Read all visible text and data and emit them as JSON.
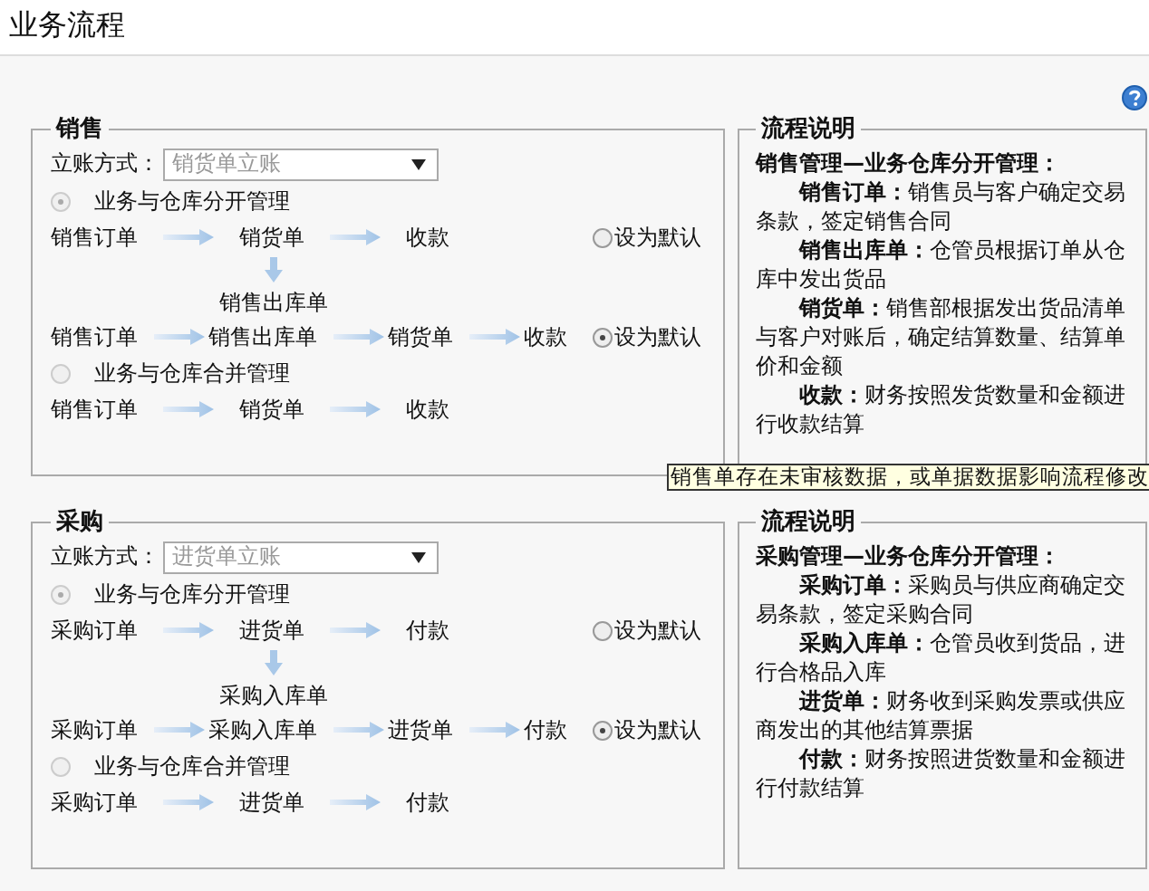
{
  "page": {
    "title": "业务流程"
  },
  "sections": [
    {
      "legend": "销售",
      "account_label": "立账方式：",
      "account_value": "销货单立账",
      "options": [
        {
          "label": "业务与仓库分开管理",
          "selected": true,
          "flows": [
            {
              "steps": [
                "销售订单",
                "销货单",
                "收款"
              ],
              "branch": "销售出库单",
              "default_label": "设为默认",
              "default_selected": false
            },
            {
              "steps": [
                "销售订单",
                "销售出库单",
                "销货单",
                "收款"
              ],
              "default_label": "设为默认",
              "default_selected": true
            }
          ]
        },
        {
          "label": "业务与仓库合并管理",
          "selected": false,
          "flows": [
            {
              "steps": [
                "销售订单",
                "销货单",
                "收款"
              ]
            }
          ]
        }
      ],
      "explanation": {
        "legend": "流程说明",
        "heading": "销售管理—业务仓库分开管理：",
        "items": [
          "**销售订单：**销售员与客户确定交易条款，签定销售合同",
          "**销售出库单：**仓管员根据订单从仓库中发出货品",
          "**销货单：**销售部根据发出货品清单与客户对账后，确定结算数量、结算单价和金额",
          "**收款：**财务按照发货数量和金额进行收款结算"
        ]
      }
    },
    {
      "legend": "采购",
      "account_label": "立账方式：",
      "account_value": "进货单立账",
      "options": [
        {
          "label": "业务与仓库分开管理",
          "selected": true,
          "flows": [
            {
              "steps": [
                "采购订单",
                "进货单",
                "付款"
              ],
              "branch": "采购入库单",
              "default_label": "设为默认",
              "default_selected": false
            },
            {
              "steps": [
                "采购订单",
                "采购入库单",
                "进货单",
                "付款"
              ],
              "default_label": "设为默认",
              "default_selected": true
            }
          ]
        },
        {
          "label": "业务与仓库合并管理",
          "selected": false,
          "flows": [
            {
              "steps": [
                "采购订单",
                "进货单",
                "付款"
              ]
            }
          ]
        }
      ],
      "explanation": {
        "legend": "流程说明",
        "heading": "采购管理—业务仓库分开管理：",
        "items": [
          "**采购订单：**采购员与供应商确定交易条款，签定采购合同",
          "**采购入库单：**仓管员收到货品，进行合格品入库",
          "**进货单：**财务收到采购发票或供应商发出的其他结算票据",
          "**付款：**财务按照进货数量和金额进行付款结算"
        ]
      }
    }
  ],
  "tooltip": "销售单存在未审核数据，或单据数据影响流程修改"
}
